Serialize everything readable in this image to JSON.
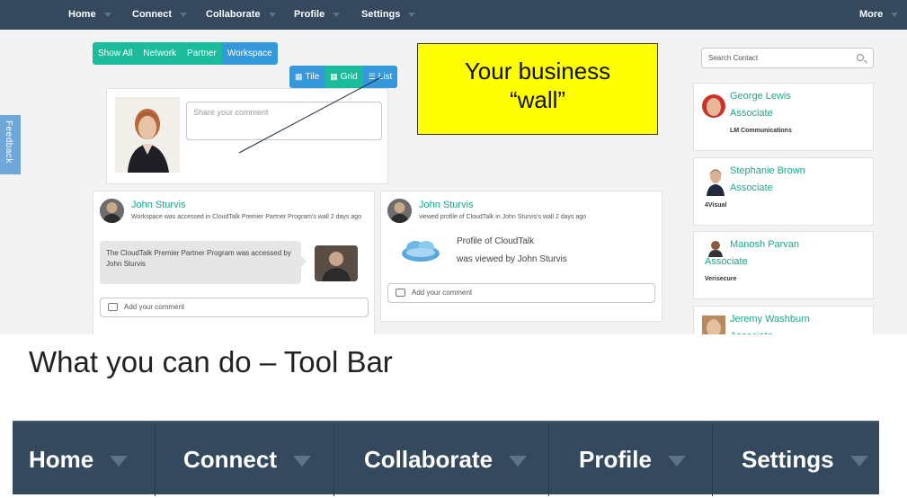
{
  "topnav": {
    "items": [
      {
        "label": "Home"
      },
      {
        "label": "Connect"
      },
      {
        "label": "Collaborate"
      },
      {
        "label": "Profile"
      },
      {
        "label": "Settings"
      }
    ],
    "more_label": "More"
  },
  "feedback_label": "Feedback",
  "filters": [
    "Show All",
    "Network",
    "Partner",
    "Workspace"
  ],
  "view_switch": [
    "Tile",
    "Grid",
    "List"
  ],
  "composer": {
    "placeholder": "Share your comment"
  },
  "callout": {
    "line1": "Your business",
    "line2": "“wall”"
  },
  "feed": [
    {
      "name": "John Sturvis",
      "subtitle": "Workspace was accessed in CloudTalk Premier Partner Program's wall 2 days ago",
      "post_text": "The CloudTalk Premier Partner Program was accessed by John Sturvis",
      "add_comment": "Add your comment"
    },
    {
      "name": "John Sturvis",
      "subtitle": "viewed profile of CloudTalk in John Sturvis's wall 2 days ago",
      "line1": "Profile of CloudTalk",
      "line2": "was viewed by John Sturvis",
      "add_comment": "Add your comment"
    }
  ],
  "search_contact": {
    "placeholder": "Search Contact"
  },
  "contacts": [
    {
      "name": "George Lewis",
      "role": "Associate",
      "company": "LM Communications"
    },
    {
      "name": "Stephanie Brown",
      "role": "Associate",
      "company": "4Visual"
    },
    {
      "name": "Manosh Parvan",
      "role": "Associate",
      "company": "Verisecure"
    },
    {
      "name": "Jeremy Washburn",
      "role": "Associate"
    }
  ],
  "section_heading": "What you can do – Tool Bar",
  "toolbar_zoom": [
    "Home",
    "Connect",
    "Collaborate",
    "Profile",
    "Settings"
  ],
  "colors": {
    "nav_bg": "#34495e",
    "teal": "#1abc9c",
    "blue": "#3498db",
    "callout_yellow": "#ffff00",
    "link_green": "#1aa98c"
  }
}
